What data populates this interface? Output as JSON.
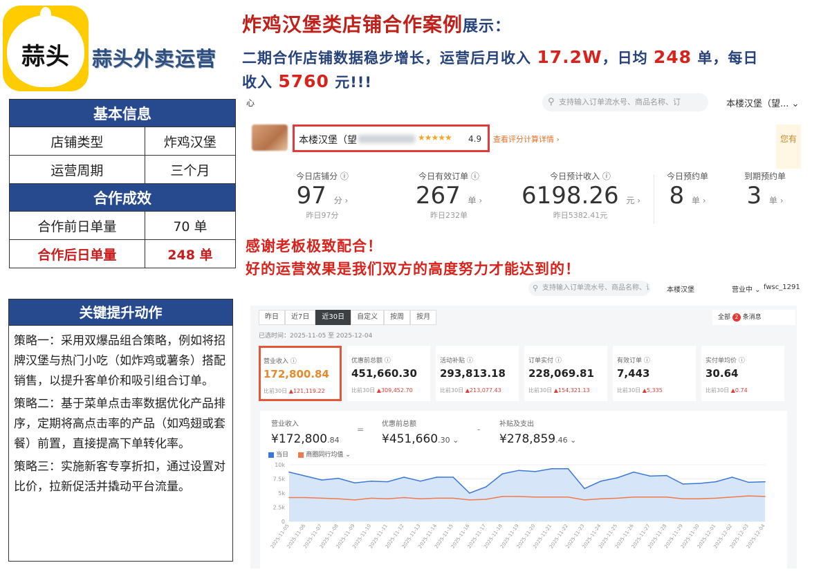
{
  "brand": {
    "logo_text": "蒜头",
    "name": "蒜头外卖运营"
  },
  "headline": {
    "title": "炸鸡汉堡类店铺合作案例",
    "title_tail": "展示：",
    "line1_a": "二期合作店铺数据稳步增长，运营后月收入",
    "line1_monthly": "17.2W",
    "line1_b": "，日均",
    "line1_daily_orders": "248",
    "line1_c": "单，每日",
    "line2_a": "收入",
    "line2_daily_income": "5760",
    "line2_b": "元!!!"
  },
  "info_table": {
    "section1": "基本信息",
    "rows1": [
      {
        "label": "店铺类型",
        "value": "炸鸡汉堡"
      },
      {
        "label": "运营周期",
        "value": "三个月"
      }
    ],
    "section2": "合作成效",
    "rows2": [
      {
        "label": "合作前日单量",
        "value": "70 单"
      },
      {
        "label": "合作后日单量",
        "value": "248 单"
      }
    ]
  },
  "actions": {
    "title": "关键提升动作",
    "items": [
      "策略一：采用双爆品组合策略，例如将招牌汉堡与热门小吃（如炸鸡或薯条）搭配销售，以提升客单价和吸引组合订单。",
      "策略二：基于菜单点击率数据优化产品排序，定期将高点击率的产品（如鸡翅或套餐）前置，直接提高下单转化率。",
      "策略三：实施新客专享折扣，通过设置对比价，拉新促活并撬动平台流量。"
    ]
  },
  "shot1": {
    "heart": "心",
    "search_placeholder": "支持输入订单流水号、商品名称、订",
    "shop_select": "本楼汉堡（望... ⌄",
    "shop_name": "本楼汉堡（望",
    "stars": "★★★★★",
    "score": "4.9",
    "rate_link": "查看评分计算详情 ›",
    "side_note": "您有",
    "stats": [
      {
        "label": "今日店铺分 ⓘ",
        "value": "97",
        "unit": "分 ›",
        "sub": "昨日97分"
      },
      {
        "label": "今日有效订单 ⓘ",
        "value": "267",
        "unit": "单 ›",
        "sub": "昨日232单"
      },
      {
        "label": "今日预计收入 ⓘ",
        "value": "6198.26",
        "unit": "元 ›",
        "sub": "昨日5382.41元"
      },
      {
        "label": "今日预约单",
        "value": "8",
        "unit": "单 ›",
        "sub": ""
      },
      {
        "label": "到期预约单",
        "value": "3",
        "unit": "单 ›",
        "sub": ""
      }
    ]
  },
  "thanks": {
    "line1": "感谢老板极致配合！",
    "line2": "好的运营效果是我们双方的高度努力才能达到的！"
  },
  "shot2": {
    "search_placeholder": "支持输入订单流水号、商品名称、订",
    "shop": "本楼汉堡",
    "status": "营业中 ⌄",
    "account": "fwsc_1291",
    "tabs": [
      "昨日",
      "近7日",
      "近30日",
      "自定义",
      "按周",
      "按月"
    ],
    "active_tab": "近30日",
    "messages": {
      "prefix": "全部",
      "count": "2",
      "suffix": "条消息"
    },
    "range": "已选时间：2025-11-05 至 2025-12-04",
    "metrics": [
      {
        "label": "营业收入 ⓘ",
        "value": "172,800.84",
        "cmp_prefix": "比前30日",
        "cmp": "121,119.22"
      },
      {
        "label": "优惠前总额 ⓘ",
        "value": "451,660.30",
        "cmp_prefix": "比前30日",
        "cmp": "309,452.70"
      },
      {
        "label": "活动补贴 ⓘ",
        "value": "293,813.18",
        "cmp_prefix": "比前30日",
        "cmp": "213,077.43"
      },
      {
        "label": "订单实付 ⓘ",
        "value": "228,069.81",
        "cmp_prefix": "比前30日",
        "cmp": "154,321.13"
      },
      {
        "label": "有效订单 ⓘ",
        "value": "7,443",
        "cmp_prefix": "比前30日",
        "cmp": "5,335"
      },
      {
        "label": "实付单均价 ⓘ",
        "value": "30.64",
        "cmp_prefix": "比前30日",
        "cmp": "0.74"
      }
    ],
    "summary": [
      {
        "label": "营业收入",
        "value": "¥172,800",
        "cents": ".84",
        "op": "="
      },
      {
        "label": "优惠前总额",
        "value": "¥451,660",
        "cents": ".30 ⌄",
        "op": "-"
      },
      {
        "label": "补贴及支出",
        "value": "¥278,859",
        "cents": ".46 ⌄",
        "op": ""
      }
    ],
    "legend": {
      "a": "当日",
      "b": "商圈同行均值 ⌄"
    }
  },
  "chart_data": {
    "type": "area",
    "title": "",
    "xlabel": "",
    "ylabel": "",
    "ylim": [
      0,
      10000
    ],
    "yticks": [
      "0",
      "2.5k",
      "5k",
      "7.5k",
      "10k"
    ],
    "x": [
      "2025-11-05",
      "2025-11-06",
      "2025-11-07",
      "2025-11-08",
      "2025-11-09",
      "2025-11-10",
      "2025-11-11",
      "2025-11-12",
      "2025-11-13",
      "2025-11-14",
      "2025-11-15",
      "2025-11-16",
      "2025-11-17",
      "2025-11-18",
      "2025-11-19",
      "2025-11-20",
      "2025-11-21",
      "2025-11-22",
      "2025-11-23",
      "2025-11-24",
      "2025-11-25",
      "2025-11-26",
      "2025-11-27",
      "2025-11-28",
      "2025-11-29",
      "2025-11-30",
      "2025-12-01",
      "2025-12-02",
      "2025-12-03",
      "2025-12-04"
    ],
    "series": [
      {
        "name": "当日",
        "color": "#3a78d8",
        "values": [
          8700,
          8000,
          7300,
          7600,
          6800,
          7100,
          7000,
          7800,
          7100,
          7800,
          7800,
          5000,
          6100,
          8400,
          9000,
          8800,
          9300,
          9300,
          5800,
          7100,
          7700,
          8700,
          8000,
          8100,
          6600,
          6700,
          7000,
          7800,
          6900,
          7000
        ]
      },
      {
        "name": "商圈同行均值",
        "color": "#f07a4a",
        "values": [
          4200,
          4200,
          4100,
          4000,
          3800,
          4100,
          4000,
          4200,
          4000,
          4100,
          4100,
          3800,
          3900,
          4400,
          4400,
          4300,
          4300,
          4300,
          3800,
          4000,
          4100,
          4300,
          4300,
          4300,
          4000,
          4000,
          4100,
          4300,
          4500,
          4400
        ]
      }
    ]
  }
}
